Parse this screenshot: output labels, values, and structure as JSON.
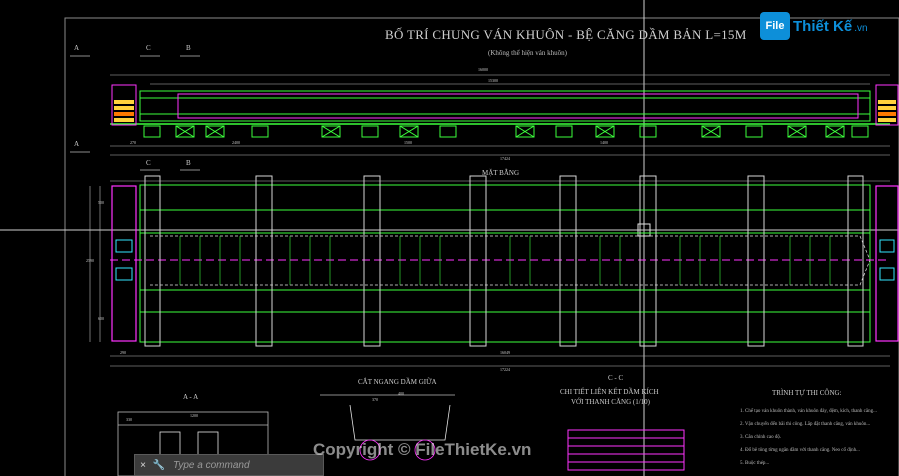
{
  "drawing": {
    "title": "BỐ TRÍ CHUNG VÁN KHUÔN - BỆ CĂNG DẦM BẢN L=15M",
    "subtitle": "(Không thể hiện ván khuôn)",
    "plan_label": "MẶT BẰNG",
    "section_labels": {
      "a_top": "A",
      "c_top": "C",
      "b_top": "B",
      "a_mid": "A",
      "c_mid": "C",
      "b_mid": "B",
      "aa": "A - A",
      "cut": "CẮT NGANG DẦM GIỮA",
      "cc": "C - C",
      "detail_1": "CHI TIẾT LIÊN KẾT DẦM KÍCH",
      "detail_2": "VỚI THANH CĂNG (1/10)",
      "sequence": "TRÌNH TỰ THI CÔNG:"
    },
    "dims": {
      "top_total": "16000",
      "top_inner": "15300",
      "row_total": "17424",
      "plan_total": "16049",
      "plan_outer": "17224",
      "d2400": "2400",
      "d1500": "1500",
      "d270": "270",
      "d1400": "1400",
      "d500": "500",
      "d2590": "2590",
      "d400": "400",
      "d330": "330",
      "d1200": "1200",
      "d290": "290",
      "d370": "370",
      "d600": "600"
    },
    "notes": [
      "1. Chế tạo ván khuôn thành, ván khuôn đáy, đệm, kích, thanh căng...",
      "2. Vận chuyển đến bãi thi công. Lắp đặt thanh căng, ván khuôn...",
      "3. Căn chỉnh cao độ.",
      "4. Đổ bê tông từng ngăn dầm với thanh căng. Neo cố định...",
      "5. Buộc thép..."
    ]
  },
  "command_line": {
    "placeholder": "Type a command",
    "close_icon": "×",
    "wrench_icon": "🔧"
  },
  "watermark": {
    "logo_box": "File",
    "logo_name": "Thiết Kế",
    "logo_domain": ".vn",
    "copyright": "Copyright © FileThietKe.vn"
  },
  "colors": {
    "green": "#3cff3c",
    "magenta": "#ff33ff",
    "white": "#e6e6e6",
    "yellow": "#ffd23c",
    "cyan": "#33e6ff"
  }
}
